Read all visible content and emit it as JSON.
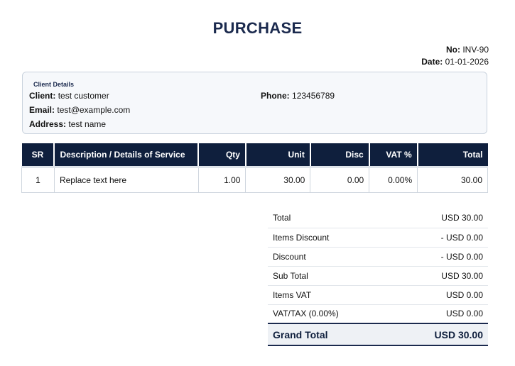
{
  "document": {
    "title": "PURCHASE"
  },
  "meta": {
    "no_label": "No:",
    "no_value": "INV-90",
    "date_label": "Date:",
    "date_value": "01-01-2026"
  },
  "client": {
    "heading": "Client Details",
    "client_label": "Client:",
    "client_value": "test customer",
    "phone_label": "Phone:",
    "phone_value": "123456789",
    "email_label": "Email:",
    "email_value": "test@example.com",
    "address_label": "Address:",
    "address_value": "test name"
  },
  "items_table": {
    "headers": [
      "SR",
      "Description / Details of Service",
      "Qty",
      "Unit",
      "Disc",
      "VAT %",
      "Total"
    ],
    "rows": [
      [
        "1",
        "Replace text here",
        "1.00",
        "30.00",
        "0.00",
        "0.00%",
        "30.00"
      ]
    ]
  },
  "totals": {
    "rows": [
      {
        "label": "Total",
        "value": "USD 30.00"
      },
      {
        "label": "Items Discount",
        "value": "- USD 0.00"
      },
      {
        "label": "Discount",
        "value": "- USD 0.00"
      },
      {
        "label": "Sub Total",
        "value": "USD 30.00"
      },
      {
        "label": "Items VAT",
        "value": "USD 0.00"
      },
      {
        "label": "VAT/TAX (0.00%)",
        "value": "USD 0.00"
      }
    ],
    "grand_label": "Grand Total",
    "grand_value": "USD 30.00"
  },
  "colors": {
    "header_bg": "#0f1f3d",
    "title": "#1b2a4e",
    "box_bg": "#f6f8fb"
  }
}
